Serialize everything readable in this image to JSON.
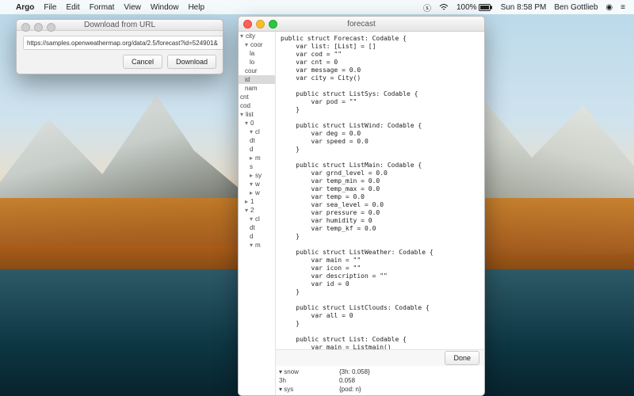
{
  "menubar": {
    "app": "Argo",
    "items": [
      "File",
      "Edit",
      "Format",
      "View",
      "Window",
      "Help"
    ],
    "battery": "100%",
    "clock": "Sun 8:58 PM",
    "user": "Ben Gottlieb"
  },
  "dialog": {
    "title": "Download from URL",
    "url": "https://samples.openweathermap.org/data/2.5/forecast?id=524901&",
    "cancel": "Cancel",
    "download": "Download"
  },
  "forecast": {
    "title": "forecast",
    "done": "Done",
    "tree": [
      {
        "d": 0,
        "t": "city",
        "o": 1
      },
      {
        "d": 1,
        "t": "coor",
        "o": 1
      },
      {
        "d": 2,
        "t": "la"
      },
      {
        "d": 2,
        "t": "lo"
      },
      {
        "d": 1,
        "t": "cour"
      },
      {
        "d": 1,
        "t": "id",
        "sel": 1
      },
      {
        "d": 1,
        "t": "nam"
      },
      {
        "d": 0,
        "t": "cnt"
      },
      {
        "d": 0,
        "t": "cod"
      },
      {
        "d": 0,
        "t": "list",
        "o": 1
      },
      {
        "d": 1,
        "t": "0",
        "o": 1
      },
      {
        "d": 2,
        "t": "cl",
        "o": 1
      },
      {
        "d": 2,
        "t": "dt"
      },
      {
        "d": 2,
        "t": "d"
      },
      {
        "d": 2,
        "t": "m",
        "o": 0
      },
      {
        "d": 2,
        "t": "s"
      },
      {
        "d": 2,
        "t": "sy",
        "o": 0
      },
      {
        "d": 2,
        "t": "w",
        "o": 1
      },
      {
        "d": 3,
        "t": ""
      },
      {
        "d": 2,
        "t": "w",
        "o": 0
      },
      {
        "d": 1,
        "t": "1",
        "o": 0
      },
      {
        "d": 1,
        "t": "2",
        "o": 1
      },
      {
        "d": 2,
        "t": "cl",
        "o": 1
      },
      {
        "d": 2,
        "t": "dt"
      },
      {
        "d": 2,
        "t": "d"
      },
      {
        "d": 2,
        "t": "m",
        "o": 1
      }
    ],
    "code": "public struct Forecast: Codable {\n    var list: [List] = []\n    var cod = \"\"\n    var cnt = 0\n    var message = 0.0\n    var city = City()\n\n    public struct ListSys: Codable {\n        var pod = \"\"\n    }\n\n    public struct ListWind: Codable {\n        var deg = 0.0\n        var speed = 0.0\n    }\n\n    public struct ListMain: Codable {\n        var grnd_level = 0.0\n        var temp_min = 0.0\n        var temp_max = 0.0\n        var temp = 0.0\n        var sea_level = 0.0\n        var pressure = 0.0\n        var humidity = 0\n        var temp_kf = 0.0\n    }\n\n    public struct ListWeather: Codable {\n        var main = \"\"\n        var icon = \"\"\n        var description = \"\"\n        var id = 0\n    }\n\n    public struct ListClouds: Codable {\n        var all = 0\n    }\n\n    public struct List: Codable {\n        var main = Listmain()\n        var clouds = Listclouds()\n        var weather: [Listweather] = []\n        var dt_txt = \"\"\n        var dt = 0\n        var sys = Listsys()\n        var wind = Listwind()\n        var snow = Listsnow()\n    }\n\n    public struct City: Codable {",
    "footer": [
      {
        "k": "▾ snow",
        "v": "{3h: 0.058}"
      },
      {
        "k": "    3h",
        "v": "0.058"
      },
      {
        "k": "▾ sys",
        "v": "{pod: n}"
      }
    ]
  }
}
